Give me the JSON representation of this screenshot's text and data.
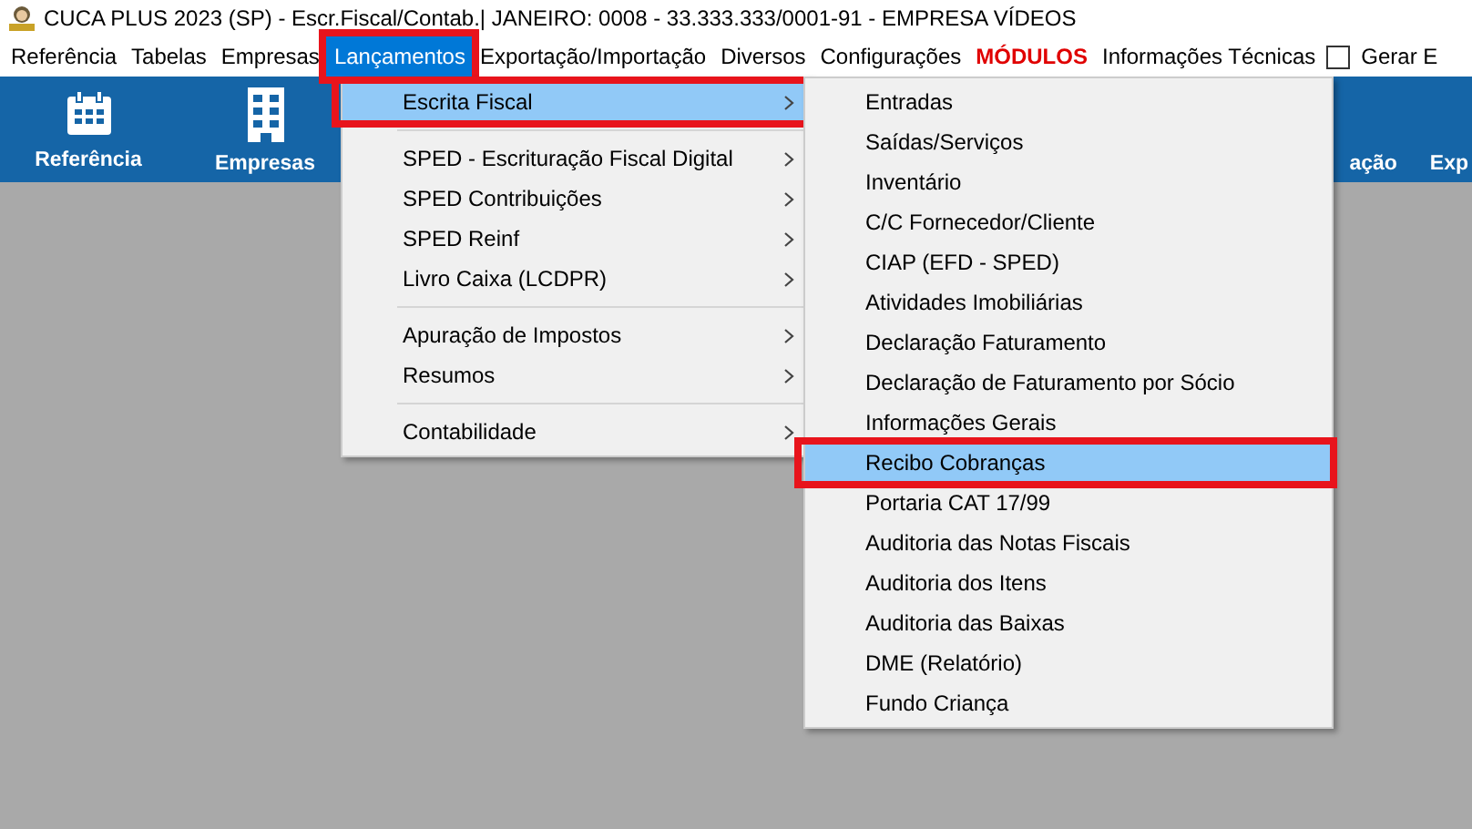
{
  "window": {
    "title": "CUCA PLUS 2023 (SP) - Escr.Fiscal/Contab.| JANEIRO: 0008 - 33.333.333/0001-91 - EMPRESA VÍDEOS"
  },
  "menu_bar": [
    {
      "label": "Referência",
      "kind": "menu",
      "selected": false,
      "annotated": false
    },
    {
      "label": "Tabelas",
      "kind": "menu",
      "selected": false,
      "annotated": false
    },
    {
      "label": "Empresas",
      "kind": "menu",
      "selected": false,
      "annotated": false
    },
    {
      "label": "Lançamentos",
      "kind": "menu",
      "selected": true,
      "annotated": true
    },
    {
      "label": "Exportação/Importação",
      "kind": "menu",
      "selected": false,
      "annotated": false
    },
    {
      "label": "Diversos",
      "kind": "menu",
      "selected": false,
      "annotated": false
    },
    {
      "label": "Configurações",
      "kind": "menu",
      "selected": false,
      "annotated": false
    },
    {
      "label": "MÓDULOS",
      "kind": "emphasis",
      "selected": false,
      "annotated": false
    },
    {
      "label": "Informações Técnicas",
      "kind": "menu",
      "selected": false,
      "annotated": false
    },
    {
      "label": "Gerar E",
      "kind": "checkbox",
      "checked": false
    }
  ],
  "toolbar": [
    {
      "label": "Referência",
      "kind": "calendar"
    },
    {
      "label": "Empresas",
      "kind": "building"
    },
    {
      "label": "ação",
      "kind": "covered"
    },
    {
      "label": "Exp",
      "kind": "covered"
    }
  ],
  "menu": {
    "groups": [
      [
        {
          "label": "Escrita Fiscal",
          "selected": true,
          "annotated": true
        }
      ],
      [
        {
          "label": "SPED - Escrituração Fiscal Digital",
          "selected": false,
          "annotated": false
        },
        {
          "label": "SPED Contribuições",
          "selected": false,
          "annotated": false
        },
        {
          "label": "SPED Reinf",
          "selected": false,
          "annotated": false
        },
        {
          "label": "Livro Caixa (LCDPR)",
          "selected": false,
          "annotated": false
        }
      ],
      [
        {
          "label": "Apuração de Impostos",
          "selected": false,
          "annotated": false
        },
        {
          "label": "Resumos",
          "selected": false,
          "annotated": false
        }
      ],
      [
        {
          "label": "Contabilidade",
          "selected": false,
          "annotated": false
        }
      ]
    ]
  },
  "submenu": {
    "items": [
      {
        "label": "Entradas",
        "selected": false,
        "annotated": false
      },
      {
        "label": "Saídas/Serviços",
        "selected": false,
        "annotated": false
      },
      {
        "label": "Inventário",
        "selected": false,
        "annotated": false
      },
      {
        "label": "C/C Fornecedor/Cliente",
        "selected": false,
        "annotated": false
      },
      {
        "label": "CIAP (EFD - SPED)",
        "selected": false,
        "annotated": false
      },
      {
        "label": "Atividades Imobiliárias",
        "selected": false,
        "annotated": false
      },
      {
        "label": "Declaração Faturamento",
        "selected": false,
        "annotated": false
      },
      {
        "label": "Declaração de Faturamento por Sócio",
        "selected": false,
        "annotated": false
      },
      {
        "label": "Informações Gerais",
        "selected": false,
        "annotated": false
      },
      {
        "label": "Recibo Cobranças",
        "selected": true,
        "annotated": true
      },
      {
        "label": "Portaria CAT 17/99",
        "selected": false,
        "annotated": false
      },
      {
        "label": "Auditoria das Notas Fiscais",
        "selected": false,
        "annotated": false
      },
      {
        "label": "Auditoria dos Itens",
        "selected": false,
        "annotated": false
      },
      {
        "label": "Auditoria das Baixas",
        "selected": false,
        "annotated": false
      },
      {
        "label": "DME (Relatório)",
        "selected": false,
        "annotated": false
      },
      {
        "label": "Fundo Criança",
        "selected": false,
        "annotated": false
      }
    ]
  }
}
